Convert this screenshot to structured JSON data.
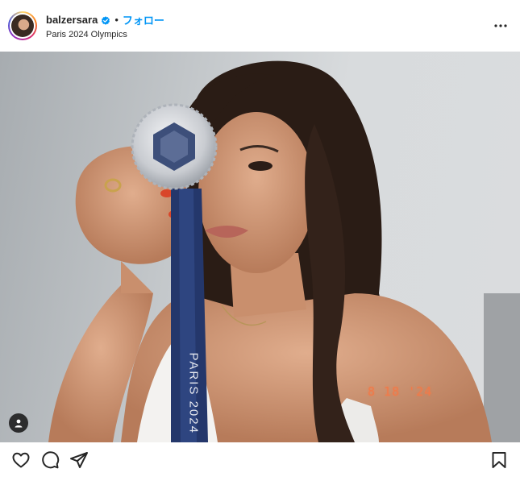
{
  "header": {
    "username": "balzersara",
    "separator": "•",
    "follow_label": "フォロー",
    "location": "Paris 2024 Olympics"
  },
  "photo": {
    "datestamp": "8 18 '24",
    "ribbon_text": "PARIS 2024"
  },
  "icons": {
    "verified": "verified-badge-icon",
    "more": "more-options-icon",
    "tag": "user-tag-icon",
    "like": "heart-icon",
    "comment": "comment-icon",
    "share": "share-icon",
    "save": "bookmark-icon"
  },
  "colors": {
    "accent": "#0095f6",
    "text": "#262626",
    "datestamp": "#f07a4a",
    "ribbon": "#24376b"
  }
}
